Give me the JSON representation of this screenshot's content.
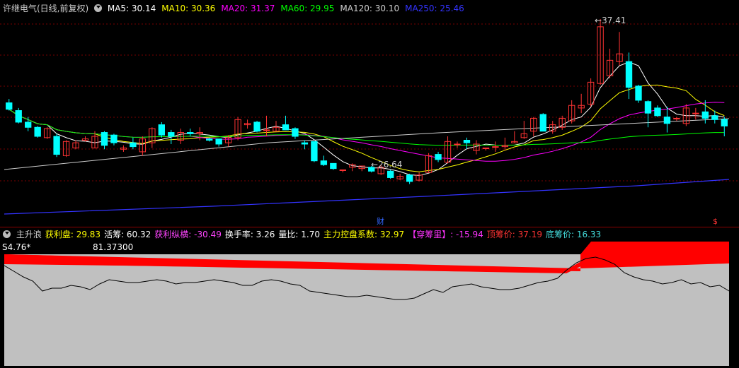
{
  "header": {
    "title": "许继电气(日线,前复权)",
    "ma": [
      {
        "label": "MA5: 30.14",
        "color": "#ffffff"
      },
      {
        "label": "MA10: 30.36",
        "color": "#ffff00"
      },
      {
        "label": "MA20: 31.37",
        "color": "#ff00ff"
      },
      {
        "label": "MA60: 29.95",
        "color": "#00ff00"
      },
      {
        "label": "MA120: 30.10",
        "color": "#cccccc"
      },
      {
        "label": "MA250: 25.46",
        "color": "#3333ff"
      }
    ]
  },
  "markers": {
    "high": "37.41",
    "low": "26.64",
    "cai": "财",
    "dollar": "$"
  },
  "indicator": {
    "items": [
      {
        "text": "主升浪",
        "color": "#cccccc"
      },
      {
        "text": "获利盘: 29.83",
        "color": "#ffff00"
      },
      {
        "text": "活筹: 60.32",
        "color": "#ffffff"
      },
      {
        "text": "获利纵横: -30.49",
        "color": "#ff44ff"
      },
      {
        "text": "换手率: 3.26",
        "color": "#ffffff"
      },
      {
        "text": "量比: 1.70",
        "color": "#ffffff"
      },
      {
        "text": "主力控盘系数: 32.97",
        "color": "#ffff00"
      },
      {
        "text": "【穿筹里】: -15.94",
        "color": "#ff33ff"
      },
      {
        "text": "顶筹价: 37.19",
        "color": "#ff3333"
      },
      {
        "text": "底筹价: 16.33",
        "color": "#44dddd"
      }
    ],
    "s_label": "S4.76*",
    "value_label": "81.37300"
  },
  "colors": {
    "up": "#ff3333",
    "down": "#00ffff",
    "red_band": "#ff0000",
    "grey_fill": "#c0c0c0"
  },
  "chart_data": {
    "type": "candlestick",
    "y_axis": [
      22.0,
      38.0
    ],
    "candles": [
      [
        30.9,
        30.4,
        31.2,
        30.3
      ],
      [
        30.3,
        29.4,
        30.5,
        29.3
      ],
      [
        29.4,
        29.0,
        29.8,
        28.7
      ],
      [
        29.0,
        28.3,
        29.1,
        28.2
      ],
      [
        28.2,
        28.9,
        29.0,
        28.1
      ],
      [
        28.3,
        26.9,
        28.5,
        26.7
      ],
      [
        26.8,
        27.9,
        28.0,
        26.7
      ],
      [
        27.4,
        27.8,
        28.0,
        27.3
      ],
      [
        28.0,
        28.1,
        28.3,
        27.9
      ],
      [
        27.4,
        28.3,
        28.7,
        27.4
      ],
      [
        28.6,
        27.6,
        28.7,
        27.3
      ],
      [
        28.4,
        27.8,
        28.5,
        27.6
      ],
      [
        27.3,
        27.4,
        27.6,
        27.1
      ],
      [
        27.8,
        27.5,
        28.2,
        27.3
      ],
      [
        27.1,
        28.1,
        28.3,
        26.8
      ],
      [
        27.8,
        28.9,
        29.0,
        27.4
      ],
      [
        29.2,
        28.4,
        29.4,
        28.2
      ],
      [
        28.6,
        28.3,
        28.8,
        27.7
      ],
      [
        28.0,
        28.6,
        28.9,
        27.7
      ],
      [
        28.6,
        28.5,
        28.9,
        28.3
      ],
      [
        28.5,
        28.6,
        29.0,
        28.0
      ],
      [
        28.1,
        28.0,
        28.2,
        27.9
      ],
      [
        28.1,
        27.7,
        28.1,
        27.5
      ],
      [
        27.8,
        28.2,
        28.4,
        27.5
      ],
      [
        28.2,
        29.6,
        29.8,
        28.0
      ],
      [
        29.2,
        29.3,
        29.6,
        28.9
      ],
      [
        29.4,
        28.7,
        29.5,
        28.6
      ],
      [
        28.8,
        28.8,
        29.9,
        28.3
      ],
      [
        28.7,
        29.0,
        29.5,
        28.7
      ],
      [
        29.2,
        28.8,
        29.9,
        28.8
      ],
      [
        28.9,
        28.3,
        29.0,
        28.1
      ],
      [
        27.8,
        27.7,
        28.0,
        27.3
      ],
      [
        27.9,
        26.4,
        27.9,
        26.3
      ],
      [
        26.4,
        26.1,
        26.8,
        26.0
      ],
      [
        26.2,
        25.8,
        26.2,
        25.7
      ],
      [
        25.7,
        25.7,
        25.7,
        25.5
      ],
      [
        25.9,
        26.1,
        26.2,
        25.6
      ],
      [
        25.8,
        26.0,
        26.0,
        25.6
      ],
      [
        25.9,
        25.6,
        26.0,
        25.5
      ],
      [
        25.4,
        25.9,
        26.1,
        25.3
      ],
      [
        25.6,
        25.1,
        25.7,
        25.0
      ],
      [
        25.0,
        25.2,
        25.4,
        24.9
      ],
      [
        25.3,
        24.8,
        25.4,
        24.6
      ],
      [
        24.9,
        25.3,
        25.5,
        24.8
      ],
      [
        25.5,
        26.8,
        27.0,
        25.5
      ],
      [
        26.9,
        26.5,
        27.1,
        26.3
      ],
      [
        26.3,
        27.9,
        28.3,
        26.2
      ],
      [
        27.7,
        27.7,
        27.9,
        27.4
      ],
      [
        28.0,
        27.8,
        28.2,
        27.3
      ],
      [
        27.2,
        27.7,
        28.0,
        26.9
      ],
      [
        27.4,
        27.4,
        27.4,
        27.2
      ],
      [
        27.5,
        27.5,
        27.9,
        27.1
      ],
      [
        27.5,
        27.6,
        28.2,
        27.2
      ],
      [
        27.8,
        27.9,
        28.7,
        27.8
      ],
      [
        28.2,
        28.5,
        29.5,
        28.1
      ],
      [
        28.7,
        29.7,
        29.8,
        28.3
      ],
      [
        30.0,
        28.7,
        30.1,
        28.7
      ],
      [
        28.7,
        29.2,
        29.5,
        28.5
      ],
      [
        29.0,
        29.7,
        29.9,
        28.8
      ],
      [
        29.5,
        30.7,
        31.1,
        29.3
      ],
      [
        30.5,
        30.7,
        31.6,
        30.1
      ],
      [
        30.8,
        32.5,
        32.8,
        30.6
      ],
      [
        32.4,
        36.8,
        37.4,
        32.3
      ],
      [
        33.0,
        34.2,
        35.1,
        32.8
      ],
      [
        34.1,
        34.7,
        36.4,
        33.8
      ],
      [
        34.1,
        32.1,
        34.8,
        31.2
      ],
      [
        32.2,
        31.1,
        32.3,
        30.9
      ],
      [
        31.0,
        30.1,
        31.1,
        29.0
      ],
      [
        30.5,
        29.9,
        30.7,
        29.8
      ],
      [
        29.8,
        29.3,
        30.6,
        28.6
      ],
      [
        29.7,
        29.7,
        29.8,
        29.5
      ],
      [
        29.3,
        30.5,
        30.8,
        29.1
      ],
      [
        30.1,
        30.1,
        30.5,
        29.6
      ],
      [
        30.2,
        29.7,
        31.1,
        29.3
      ],
      [
        29.9,
        29.6,
        30.3,
        29.3
      ],
      [
        29.6,
        29.1,
        29.8,
        28.3
      ]
    ]
  }
}
